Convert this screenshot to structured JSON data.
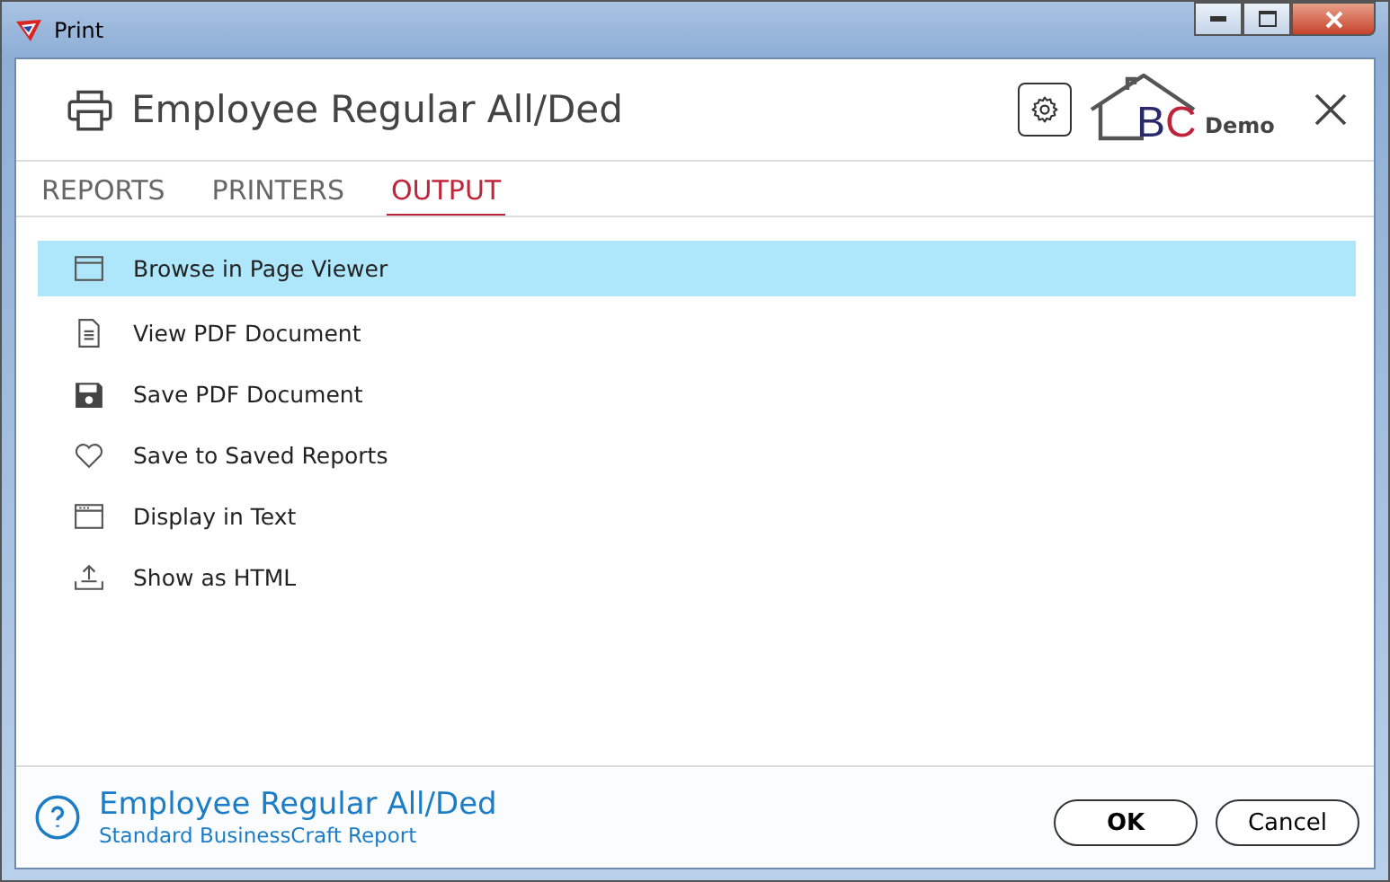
{
  "window": {
    "title": "Print"
  },
  "header": {
    "title": "Employee Regular All/Ded",
    "logo": {
      "letter_1": "B",
      "letter_2": "C",
      "caption": "Demo"
    }
  },
  "tabs": [
    {
      "label": "REPORTS",
      "selected": false
    },
    {
      "label": "PRINTERS",
      "selected": false
    },
    {
      "label": "OUTPUT",
      "selected": true
    }
  ],
  "outputs": [
    {
      "label": "Browse in Page Viewer",
      "kind": "window",
      "selected": true
    },
    {
      "label": "View PDF Document",
      "kind": "document",
      "selected": false
    },
    {
      "label": "Save PDF Document",
      "kind": "floppy",
      "selected": false
    },
    {
      "label": "Save to Saved Reports",
      "kind": "heart",
      "selected": false
    },
    {
      "label": "Display in Text",
      "kind": "textwindow",
      "selected": false
    },
    {
      "label": "Show as HTML",
      "kind": "upload",
      "selected": false
    }
  ],
  "footer": {
    "title": "Employee Regular All/Ded",
    "subtitle": "Standard BusinessCraft Report"
  },
  "buttons": [
    "OK",
    "Cancel"
  ]
}
